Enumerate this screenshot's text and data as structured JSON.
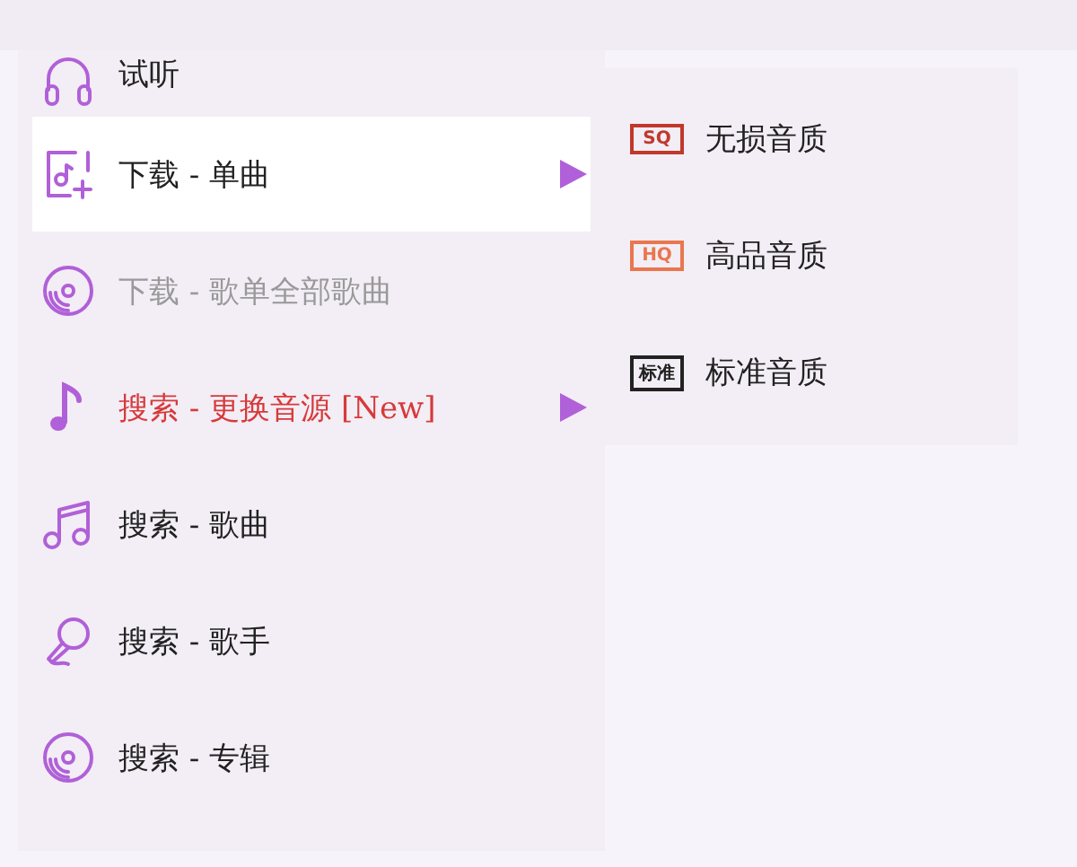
{
  "menu": {
    "items": [
      {
        "label": "试听",
        "selected": false,
        "disabled": false,
        "alert": false,
        "has_submenu": false
      },
      {
        "label": "下载 - 单曲",
        "selected": true,
        "disabled": false,
        "alert": false,
        "has_submenu": true
      },
      {
        "label": "下载 - 歌单全部歌曲",
        "selected": false,
        "disabled": true,
        "alert": false,
        "has_submenu": false
      },
      {
        "label": "搜索 - 更换音源 [New]",
        "selected": false,
        "disabled": false,
        "alert": true,
        "has_submenu": true
      },
      {
        "label": "搜索 - 歌曲",
        "selected": false,
        "disabled": false,
        "alert": false,
        "has_submenu": false
      },
      {
        "label": "搜索 - 歌手",
        "selected": false,
        "disabled": false,
        "alert": false,
        "has_submenu": false
      },
      {
        "label": "搜索 - 专辑",
        "selected": false,
        "disabled": false,
        "alert": false,
        "has_submenu": false
      }
    ]
  },
  "submenu": {
    "items": [
      {
        "badge": "SQ",
        "label": "无损音质",
        "color": "#c0392b"
      },
      {
        "badge": "HQ",
        "label": "高品音质",
        "color": "#e8774f"
      },
      {
        "badge": "标准",
        "label": "标准音质",
        "color": "#222222"
      }
    ]
  }
}
